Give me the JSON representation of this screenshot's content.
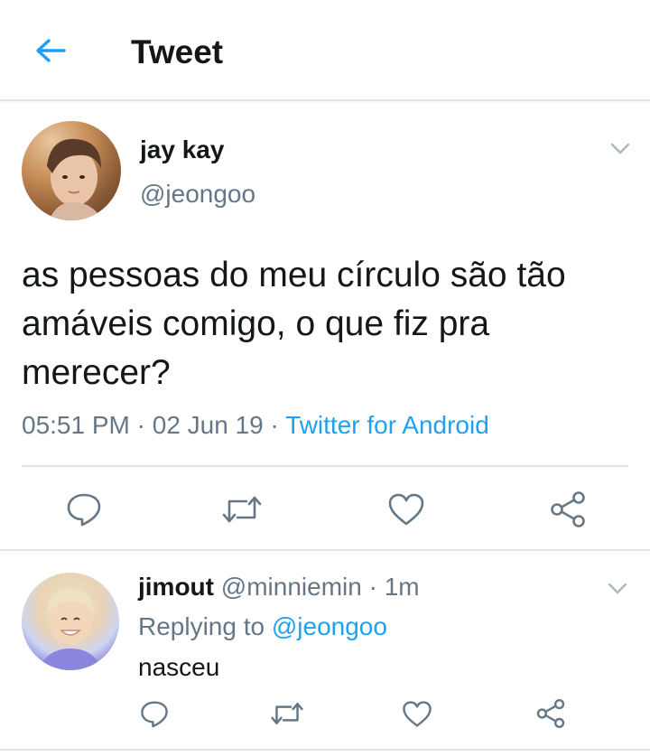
{
  "header": {
    "back_icon": "arrow-left-icon",
    "title": "Tweet",
    "accent_color": "#1da1f2"
  },
  "tweet": {
    "author_name": "jay kay",
    "author_handle": "@jeongoo",
    "avatar_icon": "user-avatar",
    "menu_icon": "chevron-down-icon",
    "text": "as pessoas do meu círculo são tão amáveis comigo, o que fiz pra merecer?",
    "time": "05:51 PM",
    "separator": " · ",
    "date": "02 Jun 19",
    "source": "Twitter for Android",
    "actions": [
      "reply-icon",
      "retweet-icon",
      "like-icon",
      "share-icon"
    ]
  },
  "reply": {
    "author_name": "jimout",
    "author_handle": "@minniemin",
    "separator": " · ",
    "age": "1m",
    "replying_prefix": "Replying to ",
    "replying_to": "@jeongoo",
    "text": "nasceu",
    "menu_icon": "chevron-down-icon",
    "actions": [
      "reply-icon",
      "retweet-icon",
      "like-icon",
      "share-icon"
    ]
  },
  "colors": {
    "text_primary": "#14171a",
    "text_secondary": "#657786",
    "divider": "#e1e4e6",
    "icon": "#657786"
  }
}
